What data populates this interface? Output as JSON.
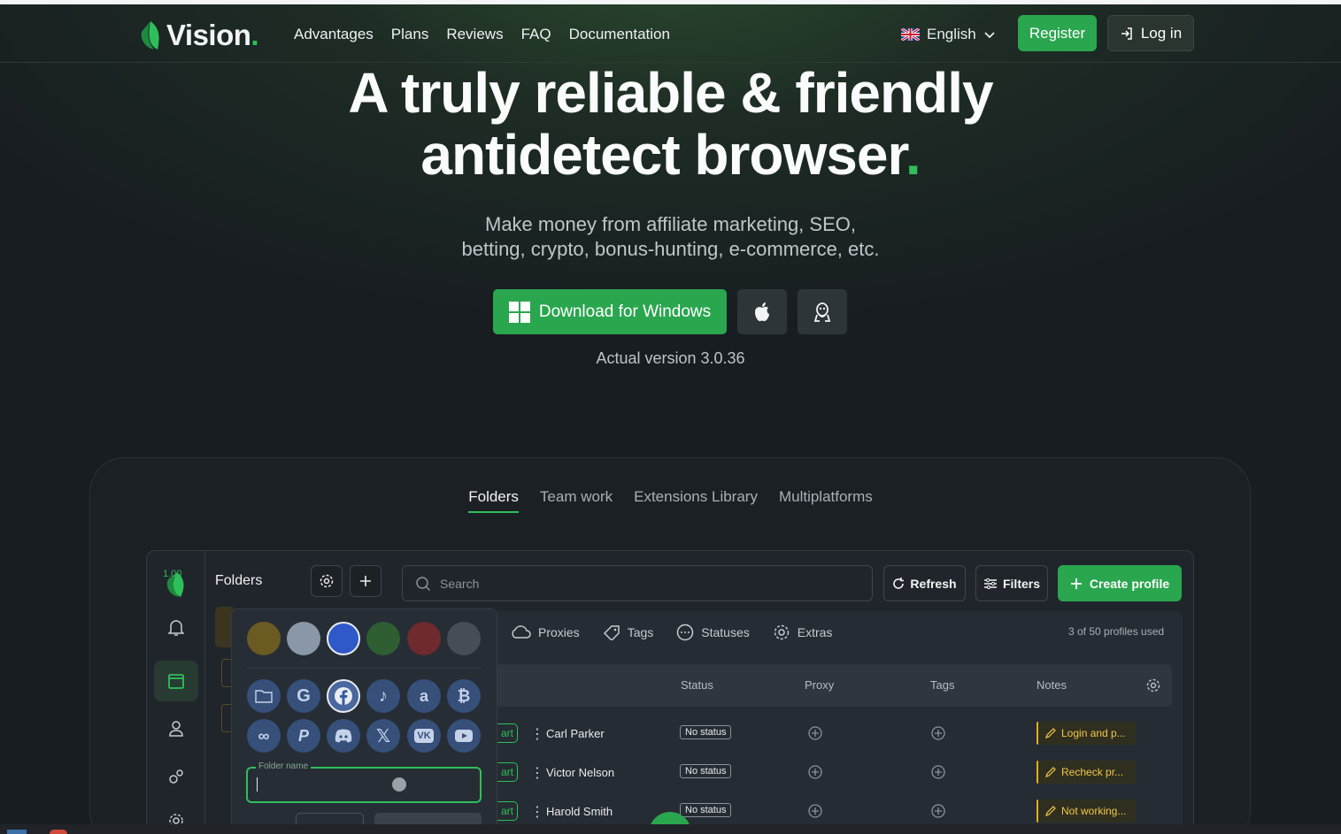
{
  "header": {
    "brand": "Vision",
    "nav": [
      "Advantages",
      "Plans",
      "Reviews",
      "FAQ",
      "Documentation"
    ],
    "language": "English",
    "register_label": "Register",
    "login_label": "Log in"
  },
  "hero": {
    "title_line1": "A truly reliable & friendly",
    "title_line2": "antidetect browser",
    "title_dot": ".",
    "subtitle_line1": "Make money from affiliate marketing, SEO,",
    "subtitle_line2": "betting, crypto, bonus-hunting, e-commerce, etc.",
    "download_label": "Download for Windows",
    "version": "Actual version 3.0.36"
  },
  "showcase": {
    "tabs": [
      {
        "label": "Folders",
        "active": true
      },
      {
        "label": "Team work",
        "active": false
      },
      {
        "label": "Extensions Library",
        "active": false
      },
      {
        "label": "Multiplatforms",
        "active": false
      }
    ]
  },
  "app": {
    "version_badge": "1.00",
    "folders_title": "Folders",
    "search_placeholder": "Search",
    "refresh_label": "Refresh",
    "filters_label": "Filters",
    "create_label": "Create profile",
    "subtabs": [
      "Proxies",
      "Tags",
      "Statuses",
      "Extras"
    ],
    "usage": "3 of 50 profiles used",
    "columns": [
      "Status",
      "Proxy",
      "Tags",
      "Notes"
    ],
    "rows": [
      {
        "start": "art",
        "name": "Carl Parker",
        "status": "No status",
        "note": "Login and p..."
      },
      {
        "start": "art",
        "name": "Victor Nelson",
        "status": "No status",
        "note": "Recheck pr..."
      },
      {
        "start": "art",
        "name": "Harold Smith",
        "status": "No status",
        "note": "Not working..."
      }
    ],
    "popover": {
      "colors": [
        "#6b5a22",
        "#8a97a8",
        "#2f58c8",
        "#2e5e32",
        "#6e2a2e",
        "#474d54"
      ],
      "icons_row1": [
        "folder-icon",
        "google-icon",
        "facebook-icon",
        "tiktok-icon",
        "amazon-icon",
        "bitcoin-icon"
      ],
      "icons_row2": [
        "meta-icon",
        "paypal-icon",
        "discord-icon",
        "x-icon",
        "vk-icon",
        "youtube-icon"
      ],
      "folder_name_label": "Folder name"
    }
  }
}
